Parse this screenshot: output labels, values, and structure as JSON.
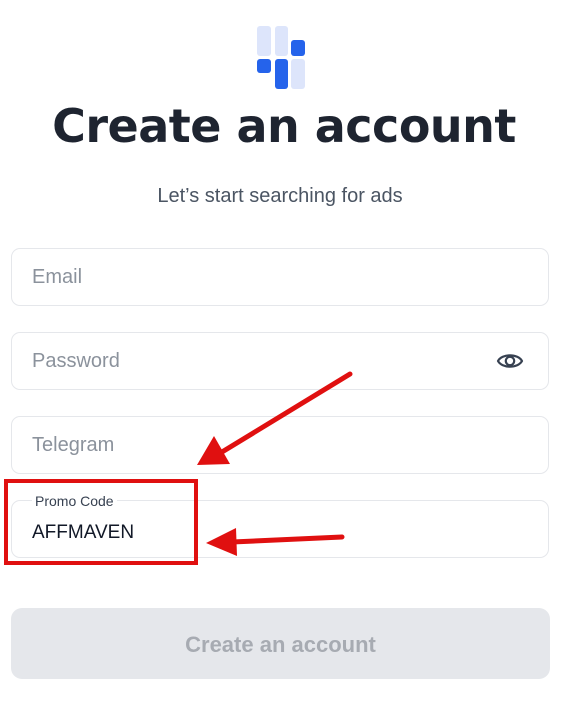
{
  "header": {
    "logo_icon": "bars-logo-icon",
    "title": "Create an account",
    "subtitle": "Let’s start searching for ads"
  },
  "form": {
    "email": {
      "placeholder": "Email",
      "value": ""
    },
    "password": {
      "placeholder": "Password",
      "value": "",
      "toggle_icon": "eye-icon"
    },
    "telegram": {
      "placeholder": "Telegram",
      "value": ""
    },
    "promo": {
      "label": "Promo Code",
      "value": "AFFMAVEN"
    },
    "submit_label": "Create an account"
  },
  "annotations": {
    "highlight_color": "#e01010",
    "arrow_icon": "red-arrow-icon"
  },
  "colors": {
    "logo_light": "#dde5fb",
    "logo_accent": "#2563eb",
    "button_bg": "#e5e7eb",
    "button_text": "#a7abb2",
    "border": "#e5e7eb"
  }
}
